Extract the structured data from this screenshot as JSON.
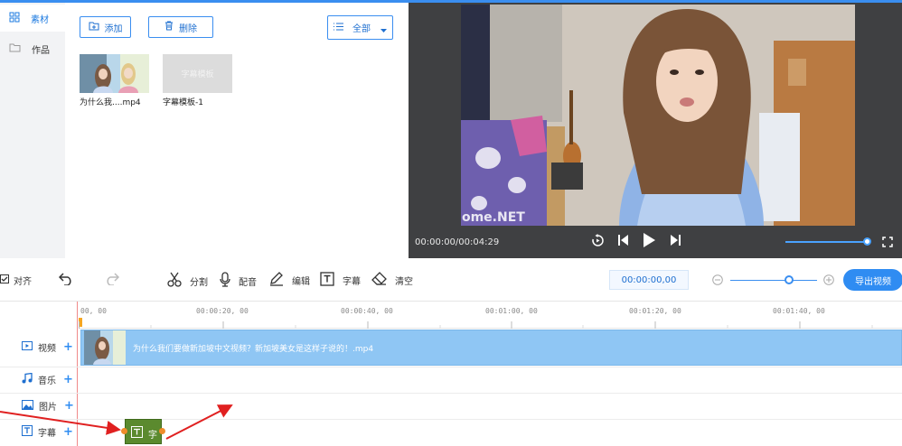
{
  "nav": {
    "items": [
      {
        "label": "素材"
      },
      {
        "label": "作品"
      }
    ]
  },
  "media": {
    "add_label": "添加",
    "delete_label": "删除",
    "filter_label": "全部",
    "files": [
      {
        "caption": "为什么我....mp4"
      },
      {
        "caption": "字幕模板-1",
        "thumb_text": "字幕模板"
      }
    ]
  },
  "player": {
    "time": "00:00:00/00:04:29",
    "watermark": "www.pHome.NET",
    "volume_fraction": 0.95
  },
  "toolbar": {
    "align_label": "对齐",
    "split_label": "分割",
    "dub_label": "配音",
    "edit_label": "编辑",
    "subtitle_label": "字幕",
    "clear_label": "清空",
    "timecode": "00:00:00,00",
    "export_label": "导出视频",
    "zoom_fraction": 0.6
  },
  "timeline": {
    "ticks": [
      "00, 00",
      "00:00:20, 00",
      "00:00:40, 00",
      "00:01:00, 00",
      "00:01:20, 00",
      "00:01:40, 00"
    ],
    "tracks": [
      {
        "label": "视频"
      },
      {
        "label": "音乐"
      },
      {
        "label": "图片"
      },
      {
        "label": "字幕"
      }
    ],
    "video_clip_text": "为什么我们要做新加坡中文视频？新加坡美女是这样子说的！.mp4",
    "subtitle_clip_text": "字"
  },
  "colors": {
    "accent": "#2f8cf2",
    "clip": "#8fc6f4",
    "subtitle_clip": "#5b8a2e",
    "arrow": "#e02020"
  }
}
